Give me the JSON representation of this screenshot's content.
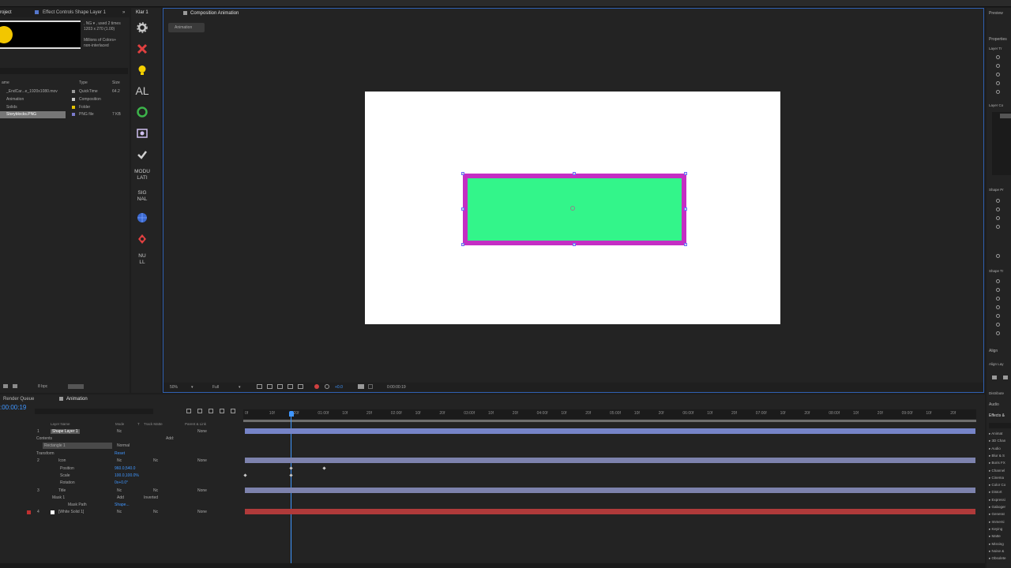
{
  "project_panel": {
    "tab_project": "roject",
    "tab_effect_controls": "Effect Controls Shape Layer 1",
    "preview_info": ", NG ▾ , used 2 times",
    "preview_dims": "1203 x 270 (1.00)",
    "preview_colors": "Millions of Colors+",
    "preview_interlace": "non-interlaced",
    "columns": {
      "name": "ame",
      "type": "Type",
      "size": "Size"
    },
    "items": [
      {
        "name": "_EndCar...e_1920x1080.mov",
        "type": "QuickTime",
        "size": "64.2"
      },
      {
        "name": "Animation",
        "type": "Composition",
        "size": ""
      },
      {
        "name": "Solids",
        "type": "Folder",
        "size": ""
      },
      {
        "name": "Storyblocks.PNG",
        "type": "PNG file",
        "size": "7 KB"
      }
    ],
    "bpc": "8 bpc"
  },
  "klar_panel": {
    "tab": "Klar 1",
    "buttons": [
      "gear-icon",
      "close-x-icon",
      "lightbulb-icon",
      "AL",
      "recycle-icon",
      "photo-icon",
      "check-icon",
      "MODU LATI",
      "SIG NAL",
      "globe-icon",
      "move-icon",
      "NU LL"
    ],
    "al": "AL",
    "modulati": "MODU LATI",
    "signal": "SIG NAL",
    "null": "NU LL"
  },
  "composition": {
    "tab": "Composition Animation",
    "breadcrumb": "Animation",
    "zoom": "50%",
    "resolution": "Full",
    "exposure": "+0.0",
    "timecode": "0:00:00:19",
    "colors": {
      "background": "#ffffff",
      "fill": "#33f58a",
      "stroke": "#c42ec4"
    }
  },
  "timeline": {
    "tab_render_queue": "Render Queue",
    "tab_animation": "Animation",
    "timecode": ":00:00:19",
    "search_placeholder": "",
    "col_layer_name": "Layer Name",
    "col_mode": "Mode",
    "col_t": "T",
    "col_track_matte": "Track Matte",
    "col_parent": "Parent & Link",
    "rows": {
      "shape_layer": {
        "num": "1",
        "name": "Shape Layer 1",
        "mode": "Nc",
        "parent": "None"
      },
      "contents": "Contents",
      "add": "Add:",
      "rectangle": "Rectangle 1",
      "rect_mode": "Normal",
      "transform": "Transform",
      "reset": "Reset",
      "icon": {
        "num": "2",
        "name": "Icon",
        "mode": "Nc",
        "tm": "Nc",
        "parent": "None"
      },
      "position": {
        "label": "Position",
        "value": "960.0,540.0"
      },
      "scale": {
        "label": "Scale",
        "value": "100.0,100.0%"
      },
      "rotation": {
        "label": "Rotation",
        "value": "0x+0.0°"
      },
      "title": {
        "num": "3",
        "name": "Title",
        "mode": "Nc",
        "tm": "Nc",
        "parent": "None"
      },
      "mask": {
        "name": "Mask 1",
        "mode": "Add",
        "inverted": "Inverted"
      },
      "mask_path": {
        "label": "Mask Path",
        "value": "Shape..."
      },
      "white_solid": {
        "num": "4",
        "name": "[White Solid 1]",
        "mode": "Nc",
        "tm": "Nc",
        "parent": "None"
      }
    },
    "ruler": [
      "0f",
      "10f",
      "20f",
      "01:00f",
      "10f",
      "20f",
      "02:00f",
      "10f",
      "20f",
      "03:00f",
      "10f",
      "20f",
      "04:00f",
      "10f",
      "20f",
      "05:00f",
      "10f",
      "20f",
      "06:00f",
      "10f",
      "20f",
      "07:00f",
      "10f",
      "20f",
      "08:00f",
      "10f",
      "20f",
      "09:00f",
      "10f",
      "20f"
    ],
    "bar_colors": {
      "shape": "#7684c8",
      "icon": "#7d82ad",
      "title": "#7d82ad",
      "solid": "#b03a3a"
    }
  },
  "right_panel": {
    "preview": "Preview",
    "properties": "Properties",
    "layer_transform": "Layer Tr",
    "layer_contents": "Layer Co",
    "shape_props": "Shape Pr",
    "shape_transform": "Shape Tr",
    "align": "Align",
    "align_layers": "Align Lay",
    "distribute": "Distribute",
    "audio": "Audio",
    "effects": "Effects &",
    "effect_list": [
      "Animat",
      "3D Chan",
      "Audio",
      "Blur & S",
      "Boris FX",
      "Channel",
      "Cinema",
      "Color Co",
      "Distort",
      "Expressi",
      "Gaboger",
      "Generat",
      "Immersi",
      "Keying",
      "Matte",
      "Missing",
      "Noise &",
      "Obsolete"
    ]
  }
}
